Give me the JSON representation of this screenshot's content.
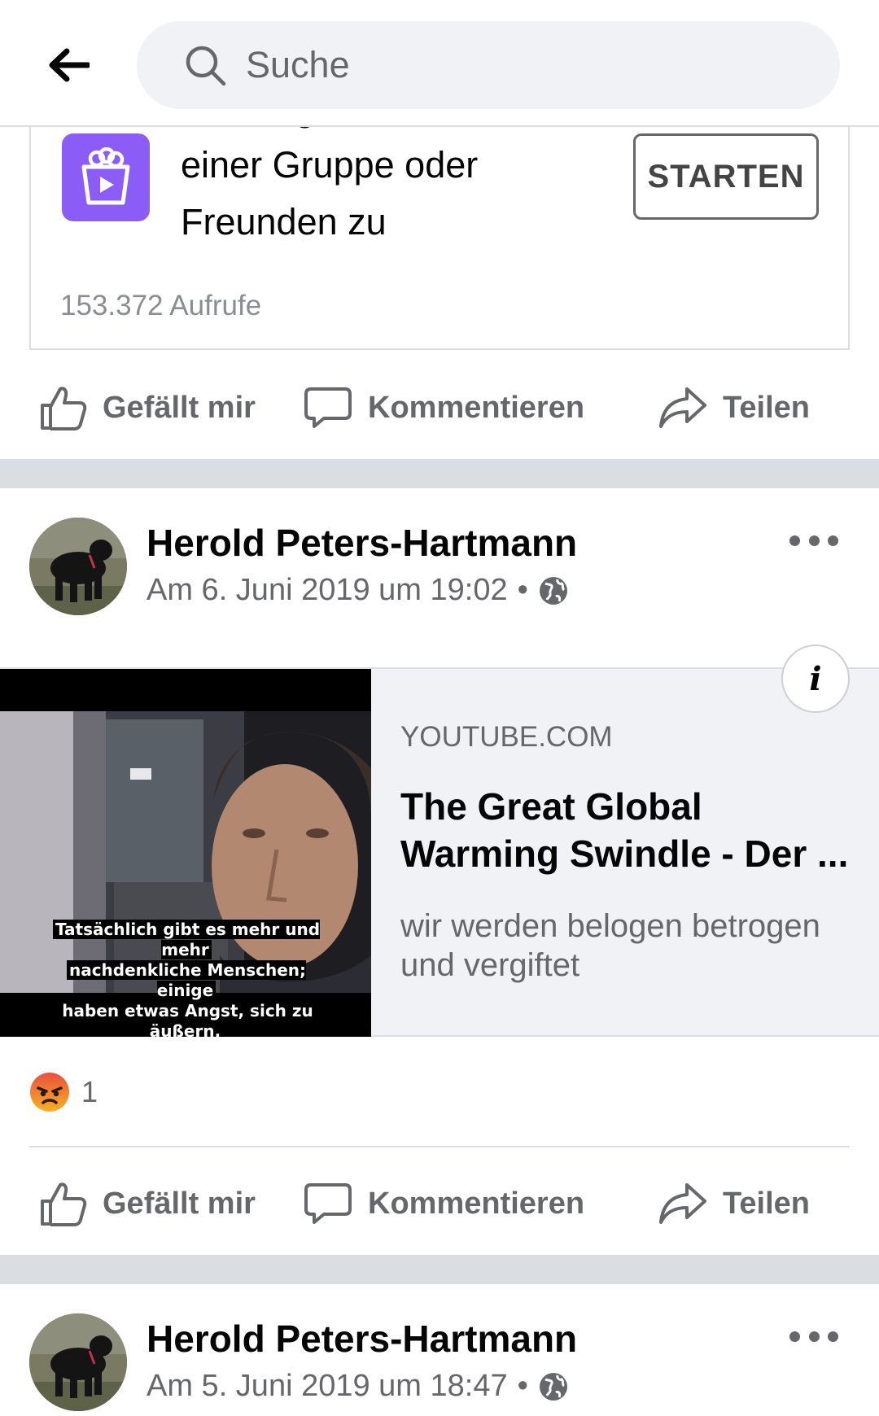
{
  "header": {
    "search_placeholder": "Suche",
    "icons": {
      "back": "arrow-left-icon",
      "search": "search-icon"
    }
  },
  "post1": {
    "watch_text_lines": [
      "Schau gemeinsam mit",
      "einer Gruppe oder",
      "Freunden zu"
    ],
    "start_label": "STARTEN",
    "views": "153.372 Aufrufe",
    "icon": "watch-party-icon",
    "accent_color": "#8b5cf6"
  },
  "actions": {
    "like": "Gefällt mir",
    "comment": "Kommentieren",
    "share": "Teilen"
  },
  "post2": {
    "author": "Herold Peters-Hartmann",
    "timestamp": "Am 6. Juni 2019 um 19:02",
    "privacy_icon": "globe-icon",
    "link": {
      "domain": "YOUTUBE.COM",
      "title": "The Great Global Warming Swindle - Der ...",
      "description": "wir werden belogen betrogen und vergiftet",
      "thumbnail_caption": [
        "Tatsächlich gibt es mehr und mehr",
        "nachdenkliche Menschen; einige",
        "haben etwas Angst, sich zu äußern,"
      ]
    },
    "reaction_icon": "angry-reaction-icon",
    "reaction_count": "1"
  },
  "post3": {
    "author": "Herold Peters-Hartmann",
    "timestamp": "Am 5. Juni 2019 um 18:47",
    "privacy_icon": "globe-icon"
  }
}
